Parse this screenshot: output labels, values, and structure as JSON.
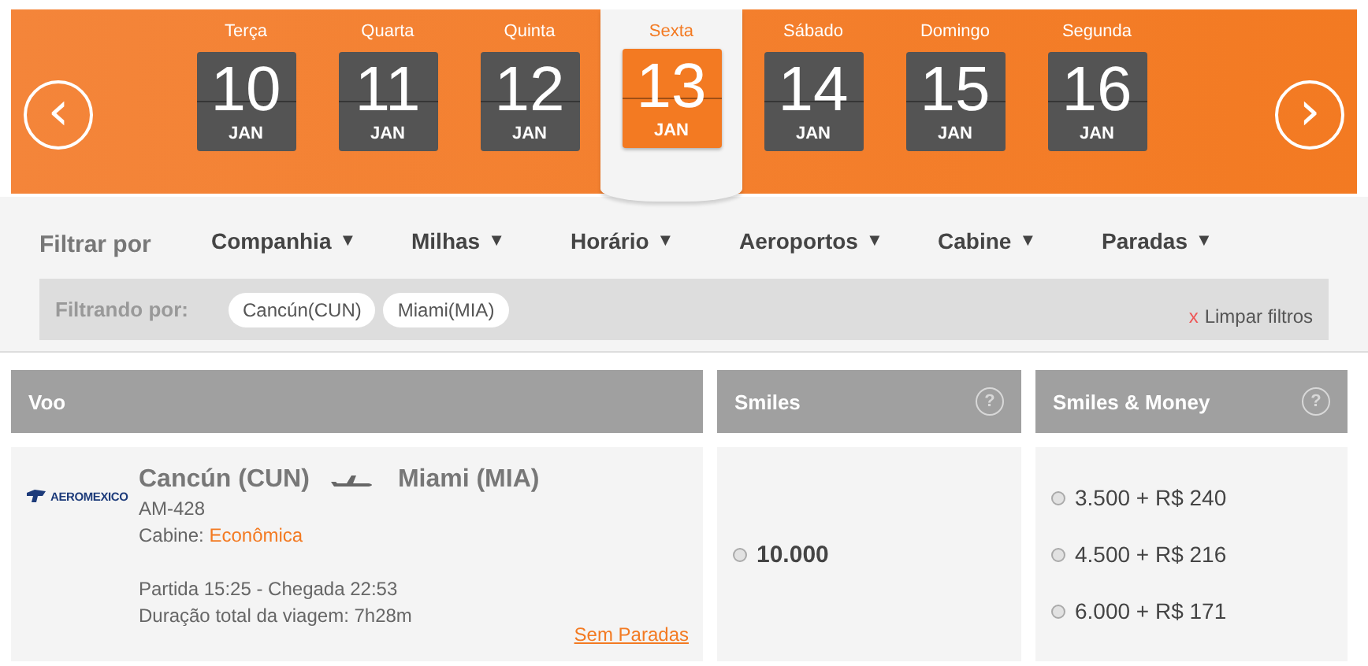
{
  "date_strip": {
    "prev": "‹",
    "next": "›",
    "days": [
      {
        "weekday": "Terça",
        "day": "10",
        "month": "JAN",
        "selected": false
      },
      {
        "weekday": "Quarta",
        "day": "11",
        "month": "JAN",
        "selected": false
      },
      {
        "weekday": "Quinta",
        "day": "12",
        "month": "JAN",
        "selected": false
      },
      {
        "weekday": "Sexta",
        "day": "13",
        "month": "JAN",
        "selected": true
      },
      {
        "weekday": "Sábado",
        "day": "14",
        "month": "JAN",
        "selected": false
      },
      {
        "weekday": "Domingo",
        "day": "15",
        "month": "JAN",
        "selected": false
      },
      {
        "weekday": "Segunda",
        "day": "16",
        "month": "JAN",
        "selected": false
      }
    ]
  },
  "filters": {
    "label": "Filtrar por",
    "dropdowns": [
      {
        "label": "Companhia",
        "caret": "▼"
      },
      {
        "label": "Milhas",
        "caret": "▼"
      },
      {
        "label": "Horário",
        "caret": "▼"
      },
      {
        "label": "Aeroportos",
        "caret": "▼"
      },
      {
        "label": "Cabine",
        "caret": "▼"
      },
      {
        "label": "Paradas",
        "caret": "▼"
      }
    ],
    "active": {
      "label": "Filtrando por:",
      "chips": [
        "Cancún(CUN)",
        "Miami(MIA)"
      ],
      "clear_x": "x",
      "clear": "Limpar filtros"
    }
  },
  "table": {
    "columns": [
      {
        "title": "Voo"
      },
      {
        "title": "Smiles",
        "help": "?"
      },
      {
        "title": "Smiles & Money",
        "help": "?"
      }
    ],
    "rows": [
      {
        "airline": "AEROMEXICO",
        "origin": "Cancún (CUN)",
        "destination": "Miami (MIA)",
        "flight": "AM-428",
        "cabin_label": "Cabine:",
        "cabin": "Econômica",
        "times": "Partida 15:25 - Chegada 22:53",
        "duration": "Duração total da viagem: 7h28m",
        "stops": "Sem Paradas",
        "smiles": [
          {
            "label": "10.000",
            "selected": false
          }
        ],
        "smiles_money": [
          {
            "label": "3.500 + R$ 240",
            "selected": false
          },
          {
            "label": "4.500 + R$ 216",
            "selected": false
          },
          {
            "label": "6.000 + R$ 171",
            "selected": false
          }
        ]
      }
    ]
  }
}
